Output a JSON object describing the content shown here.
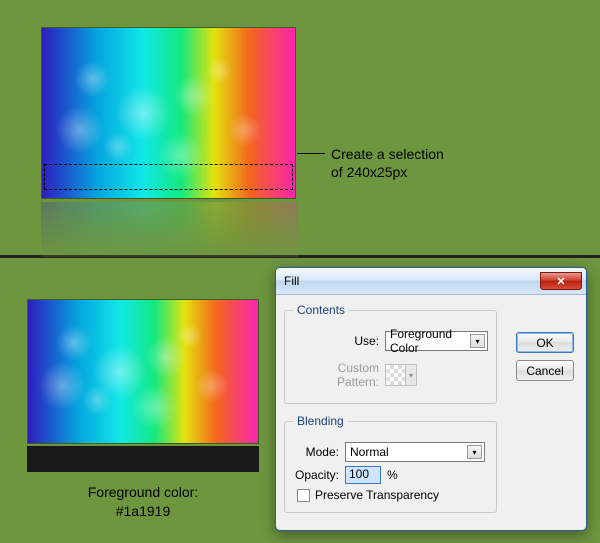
{
  "annotation": {
    "line1": "Create a selection",
    "line2": "of 240x25px"
  },
  "foreground": {
    "label": "Foreground color:",
    "value": "#1a1919"
  },
  "dialog": {
    "title": "Fill",
    "close_glyph": "✕",
    "contents": {
      "legend": "Contents",
      "use_label": "Use:",
      "use_value": "Foreground Color",
      "pattern_label": "Custom Pattern:"
    },
    "blending": {
      "legend": "Blending",
      "mode_label": "Mode:",
      "mode_value": "Normal",
      "opacity_label": "Opacity:",
      "opacity_value": "100",
      "opacity_unit": "%",
      "preserve_label": "Preserve Transparency"
    },
    "buttons": {
      "ok": "OK",
      "cancel": "Cancel"
    }
  }
}
